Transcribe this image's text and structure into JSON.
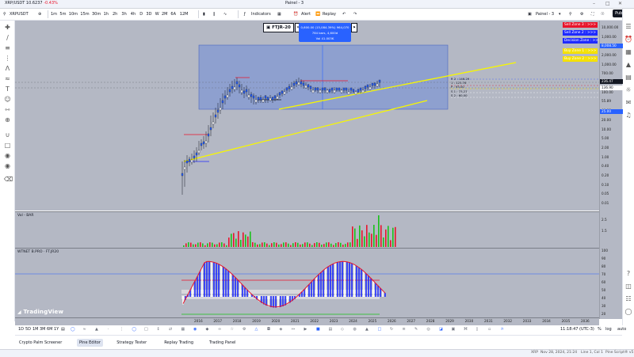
{
  "titlebar": {
    "symbol_title": "XRP/USDT 10.6237",
    "change": "-0.43%",
    "panel_name": "Painel - 3",
    "center_label": "Painel - 3"
  },
  "toolbar": {
    "symbol": "XRPUSDT",
    "intervals": [
      "1m",
      "5m",
      "10m",
      "15m",
      "30m",
      "1h",
      "2h",
      "3h",
      "4h",
      "D",
      "3D",
      "W",
      "2M",
      "6A",
      "12M"
    ],
    "indicators_label": "Indicators",
    "alert_label": "Alert",
    "replay_label": "Replay",
    "panel_label": "Painel - 3",
    "publish_label": "Publish"
  },
  "chart": {
    "indicator_tag": "FTJR-20",
    "measure_tooltip": [
      "0,600.00 (15,084.39%) 964,070",
      "784 bars, 4,600d",
      "Vol 41.003K"
    ],
    "zones": [
      {
        "label": "Sell Zone 3 : >>>",
        "bg": "#e8142b",
        "fg": "#ffffff"
      },
      {
        "label": "Sell Zone 2 : >>>",
        "bg": "#1e2aff",
        "fg": "#ffffff"
      },
      {
        "label": "Decision Zone : >>>",
        "bg": "#1e2aff",
        "fg": "#ffffff"
      },
      {
        "label": "Buy Zone 1 : >>>",
        "bg": "#f5e100",
        "fg": "#ffffff"
      },
      {
        "label": "Buy Zone 2 : >>>",
        "bg": "#f5e100",
        "fg": "#ffffff"
      }
    ],
    "fib_labels": [
      "R 2 : 146.29",
      "1 : 123.76",
      "P : 93.00",
      "S 1 : 73.27",
      "S 2 : 60.00"
    ],
    "price_axis": [
      "10,000.00",
      "1,000.00",
      "8,008.50",
      "2,000.00",
      "1,000.00",
      "700.00",
      "200.00",
      "100.00",
      "55.89",
      "40.00",
      "20.00",
      "10.00",
      "5.00",
      "2.00",
      "1.00",
      "0.40",
      "0.20",
      "0.10",
      "0.05",
      "0.01"
    ],
    "price_badges": [
      {
        "value": "8,008.50",
        "bg": "#2962ff",
        "fg": "#ffffff"
      },
      {
        "value": "236.47",
        "bg": "#131722",
        "fg": "#ffffff"
      },
      {
        "value": "136.90",
        "bg": "#ffffff",
        "fg": "#131722"
      },
      {
        "value": "25.00",
        "bg": "#2962ff",
        "fg": "#ffffff"
      }
    ]
  },
  "volume": {
    "label": "Vol - BAR",
    "axis": [
      "2.5",
      "1.5"
    ]
  },
  "rsi": {
    "label": "WTNET B.PRO · FT.JR20",
    "axis": [
      "100",
      "90",
      "80",
      "70",
      "60",
      "50",
      "40",
      "30",
      "20"
    ],
    "logo": "TradingView"
  },
  "time_axis": [
    "2016",
    "2017",
    "2018",
    "2019",
    "2020",
    "2021",
    "2022",
    "2023",
    "2024",
    "2025",
    "2026",
    "2027",
    "2028",
    "2029",
    "2030",
    "2031",
    "2032",
    "2033",
    "2034",
    "2035",
    "2036"
  ],
  "bottom": {
    "ranges": [
      "1D",
      "5D",
      "1M",
      "3M",
      "6M",
      "1Y"
    ],
    "time": "11:18:47 (UTC-3)",
    "tabs": [
      "Crypto Palm Screener",
      "Pine Editor",
      "Strategy Tester",
      "Replay Trading",
      "Trading Panel"
    ],
    "active_tab": "Pine Editor"
  },
  "statusbar": {
    "left": "XRP",
    "date": "Nov 28, 2024, 21:24",
    "line": "Line 1, Col 1",
    "right": "Pine Script® v5"
  }
}
